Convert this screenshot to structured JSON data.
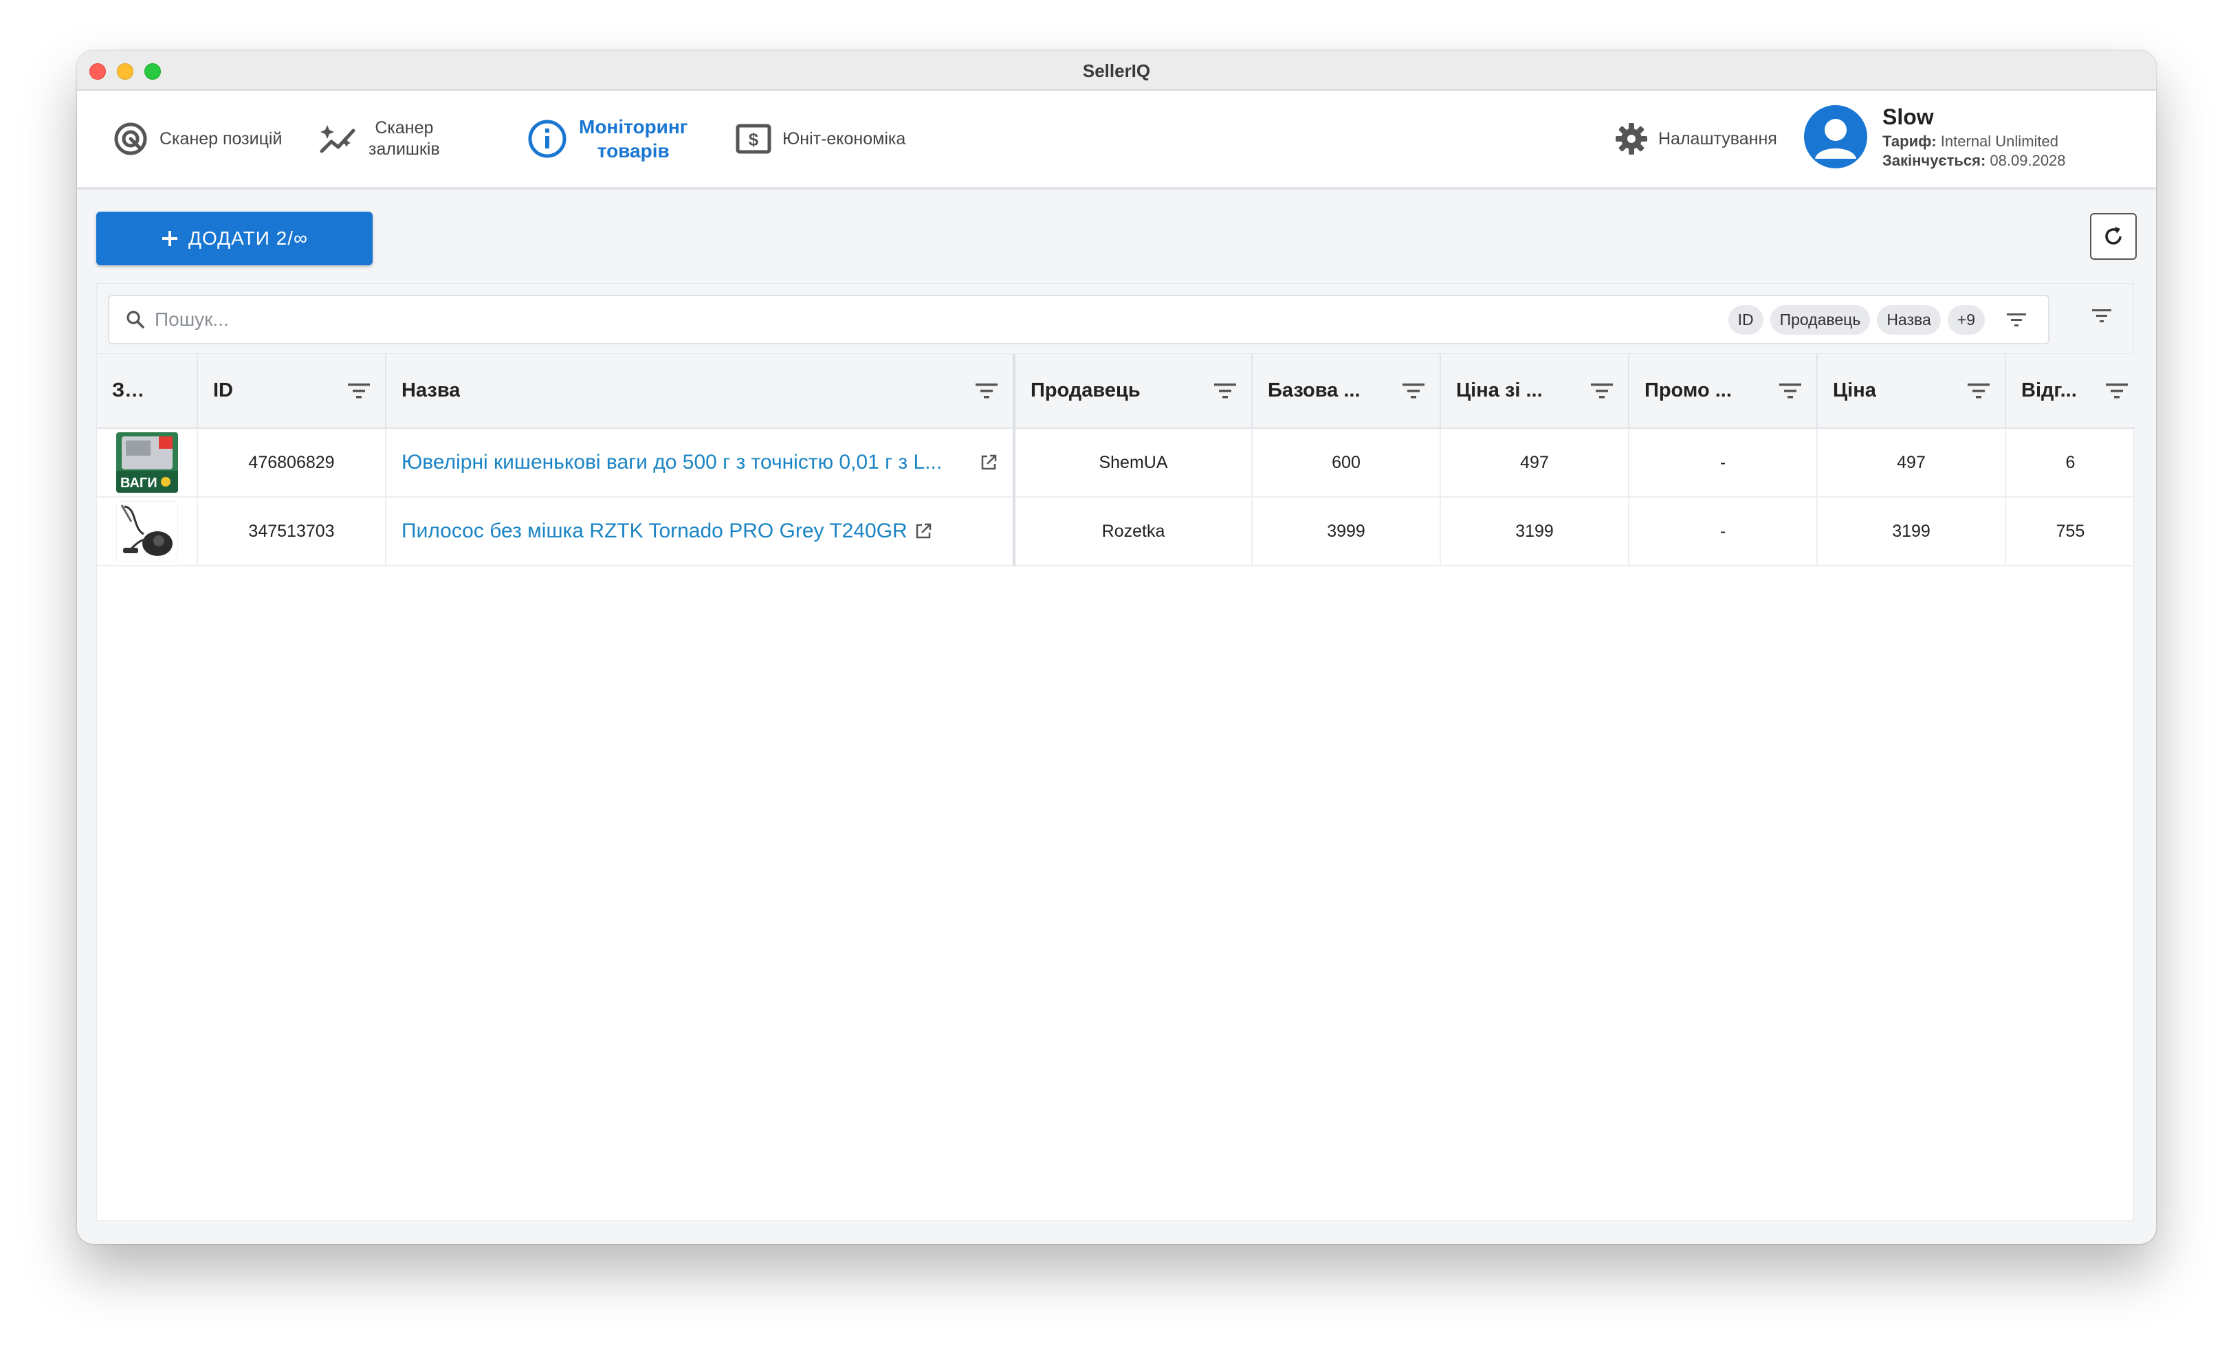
{
  "window": {
    "title": "SellerIQ"
  },
  "nav": {
    "items": [
      {
        "label": "Сканер позицій",
        "icon": "target-scan-icon"
      },
      {
        "label_line1": "Сканер",
        "label_line2": "залишків",
        "icon": "sparkle-chart-icon"
      },
      {
        "label_line1": "Моніторинг",
        "label_line2": "товарів",
        "icon": "info-circle-icon",
        "active": true
      },
      {
        "label": "Юніт-економіка",
        "icon": "dollar-bill-icon"
      }
    ],
    "settings_label": "Налаштування"
  },
  "user": {
    "name": "Slow",
    "plan_label": "Тариф:",
    "plan_value": "Internal Unlimited",
    "expires_label": "Закінчується:",
    "expires_value": "08.09.2028"
  },
  "toolbar": {
    "add_label": "ДОДАТИ 2/∞"
  },
  "search": {
    "placeholder": "Пошук...",
    "chips": [
      "ID",
      "Продавець",
      "Назва",
      "+9"
    ]
  },
  "table": {
    "columns": [
      "Зоб...",
      "ID",
      "Назва",
      "Продавець",
      "Базова ...",
      "Ціна зі ...",
      "Промо ...",
      "Ціна",
      "Відг..."
    ],
    "rows": [
      {
        "thumb": "scales-product-image",
        "thumb_text": "ВАГИ",
        "id": "476806829",
        "name": "Ювелірні кишенькові ваги до 500 г з точністю 0,01 г з L...",
        "seller": "ShemUA",
        "base_price": "600",
        "price_with_discount": "497",
        "promo": "-",
        "price": "497",
        "reviews": "6"
      },
      {
        "thumb": "vacuum-product-image",
        "id": "347513703",
        "name": "Пилосос без мішка RZTK Tornado PRO Grey T240GR",
        "seller": "Rozetka",
        "base_price": "3999",
        "price_with_discount": "3199",
        "promo": "-",
        "price": "3199",
        "reviews": "755"
      }
    ]
  },
  "colors": {
    "accent": "#1976d2",
    "link": "#1a84c4"
  }
}
